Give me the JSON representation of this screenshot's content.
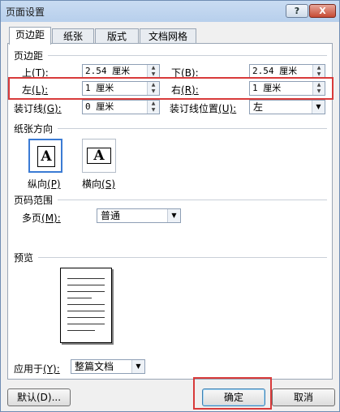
{
  "window": {
    "title": "页面设置",
    "help_label": "?",
    "close_label": "X"
  },
  "tabs": [
    {
      "label": "页边距",
      "active": true
    },
    {
      "label": "纸张",
      "active": false
    },
    {
      "label": "版式",
      "active": false
    },
    {
      "label": "文档网格",
      "active": false
    }
  ],
  "margins": {
    "group_label": "页边距",
    "top": {
      "label_text": "上",
      "hotkey": "(T):",
      "value": "2.54 厘米"
    },
    "bottom": {
      "label_text": "下",
      "hotkey": "(B):",
      "value": "2.54 厘米"
    },
    "left": {
      "label_text": "左",
      "hotkey": "(L):",
      "value": "1 厘米"
    },
    "right": {
      "label_text": "右",
      "hotkey": "(R):",
      "value": "1 厘米"
    },
    "gutter": {
      "label_text": "装订线",
      "hotkey": "(G):",
      "value": "0 厘米"
    },
    "gutter_position": {
      "label_text": "装订线位置",
      "hotkey": "(U):",
      "value": "左"
    }
  },
  "orientation": {
    "group_label": "纸张方向",
    "portrait": {
      "glyph": "A",
      "label_text": "纵向",
      "hotkey": "(P)"
    },
    "landscape": {
      "glyph": "A",
      "label_text": "横向",
      "hotkey": "(S)"
    }
  },
  "pages": {
    "group_label": "页码范围",
    "multiple_label": "多页",
    "multiple_hotkey": "(M):",
    "multiple_value": "普通"
  },
  "preview": {
    "group_label": "预览"
  },
  "apply_to": {
    "label_text": "应用于",
    "hotkey": "(Y):",
    "value": "整篇文档"
  },
  "buttons": {
    "default": "默认(D)...",
    "ok": "确定",
    "cancel": "取消"
  },
  "colors": {
    "highlight": "#d83a3a",
    "accent": "#3b7bd4"
  }
}
